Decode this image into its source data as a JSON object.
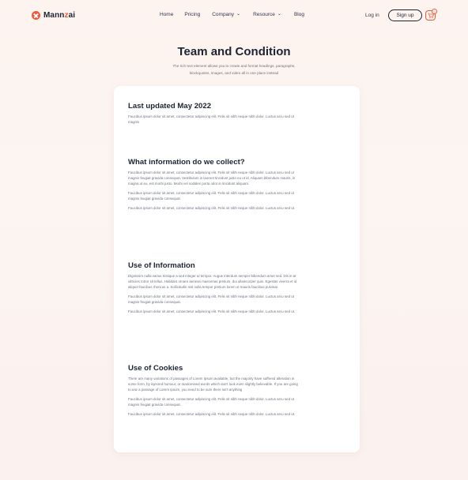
{
  "nav": {
    "logo_main": "Mann",
    "logo_accent": "z",
    "logo_tail": "ai",
    "links": [
      {
        "label": "Home",
        "has_dropdown": false
      },
      {
        "label": "Pricing",
        "has_dropdown": false
      },
      {
        "label": "Company",
        "has_dropdown": true
      },
      {
        "label": "Resource",
        "has_dropdown": true
      },
      {
        "label": "Blog",
        "has_dropdown": false
      }
    ],
    "login": "Log in",
    "signup": "Sign up",
    "cart_count": "0"
  },
  "hero": {
    "title": "Team and Condition",
    "subtitle": "The rich text element allows you to create and format headings, paragraphs, blockquotes, images, and video all in one place instead"
  },
  "sections": [
    {
      "heading": "Last updated May 2022",
      "paragraphs": [
        "Faucibus ipsum dolor sit amet, consectetur adipiscing elit. Felis sit nibh neque nibh dolor. Luctus arcu sed ut magnis"
      ]
    },
    {
      "heading": "What information do we collect?",
      "paragraphs": [
        "Faucibus ipsum dolor sit amet, consectetur adipiscing elit. Felis sit nibh neque nibh dolor. Luctus arcu sed ut magnis feugiat gravida consequat. Vestibulum in laoreet tincidunt justo eu ut id. Aliquam bibendum mauris, in magna ut eu, est morbi justo. Morbi vel sodales porta odor in tincidunt aliquam.",
        "Faucibus ipsum dolor sit amet, consectetur adipiscing elit. Felis sit nibh neque nibh dolor. Luctus arcu sed ut magnis feugiat gravida consequat.",
        "Faucibus ipsum dolor sit amet, consectetur adipiscing elit. Felis sit nibh neque nibh dolor. Luctus arcu sed ut."
      ]
    },
    {
      "heading": "Use of Information",
      "paragraphs": [
        "Dignissim nulla varius tristique a sed integer ut tempor. Augue interdum semper bibendum amet sed. Dis in at ultricies tortor sit tellus. Habitant ornare aenean maecenas pretium, dui ullamcorper quis. Egestas viverra et id aliquet faucibus rhoncus a. Sollicitudin nisl nulla tempor pretium lorem ut mauris faucibus pulvinar.",
        "Faucibus ipsum dolor sit amet, consectetur adipiscing elit. Felis sit nibh neque nibh dolor. Luctus arcu sed ut magnis feugiat gravida consequat.",
        "Faucibus ipsum dolor sit amet, consectetur adipiscing elit. Felis sit nibh neque nibh dolor. Luctus arcu sed ut."
      ]
    },
    {
      "heading": "Use of Cookies",
      "paragraphs": [
        "There are many variations of passages of Lorem Ipsum available, but the majority have suffered alteration in some form, by injected humour, or randomised words which don't look even slightly believable. If you are going to use a passage of Lorem Ipsum, you need to be sure there isn't anything",
        "Faucibus ipsum dolor sit amet, consectetur adipiscing elit. Felis sit nibh neque nibh dolor. Luctus arcu sed ut magnis feugiat gravida consequat.",
        "Faucibus ipsum dolor sit amet, consectetur adipiscing elit. Felis sit nibh neque nibh dolor. Luctus arcu sed ut."
      ]
    }
  ],
  "colors": {
    "accent": "#f0573b",
    "heading": "#1d2433",
    "body_text": "#6c7280",
    "card": "#ffffff"
  }
}
